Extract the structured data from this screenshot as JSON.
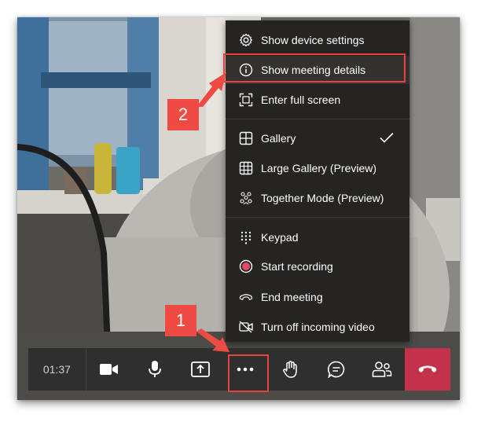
{
  "toolbar": {
    "timer": "01:37",
    "buttons": [
      {
        "name": "camera",
        "icon": "video-camera-icon"
      },
      {
        "name": "mic",
        "icon": "microphone-icon"
      },
      {
        "name": "share",
        "icon": "share-tray-icon"
      },
      {
        "name": "more",
        "icon": "more-ellipsis-icon"
      },
      {
        "name": "raise-hand",
        "icon": "raise-hand-icon"
      },
      {
        "name": "chat",
        "icon": "chat-bubble-icon"
      },
      {
        "name": "participants",
        "icon": "people-icon"
      },
      {
        "name": "hang-up",
        "icon": "hang-up-phone-icon"
      }
    ],
    "hangup_color": "#c4314b"
  },
  "menu": {
    "items": [
      {
        "label": "Show device settings",
        "icon": "gear-icon"
      },
      {
        "label": "Show meeting details",
        "icon": "info-icon"
      },
      {
        "label": "Enter full screen",
        "icon": "fullscreen-icon"
      },
      {
        "label": "Gallery",
        "icon": "gallery-grid-icon",
        "checked": true
      },
      {
        "label": "Large Gallery (Preview)",
        "icon": "large-gallery-icon"
      },
      {
        "label": "Together Mode (Preview)",
        "icon": "together-mode-icon"
      },
      {
        "label": "Keypad",
        "icon": "keypad-icon"
      },
      {
        "label": "Start recording",
        "icon": "record-icon"
      },
      {
        "label": "End meeting",
        "icon": "end-meeting-icon"
      },
      {
        "label": "Turn off incoming video",
        "icon": "video-off-icon"
      }
    ]
  },
  "callouts": {
    "step1": "1",
    "step2": "2",
    "accent": "#ef4b43"
  }
}
